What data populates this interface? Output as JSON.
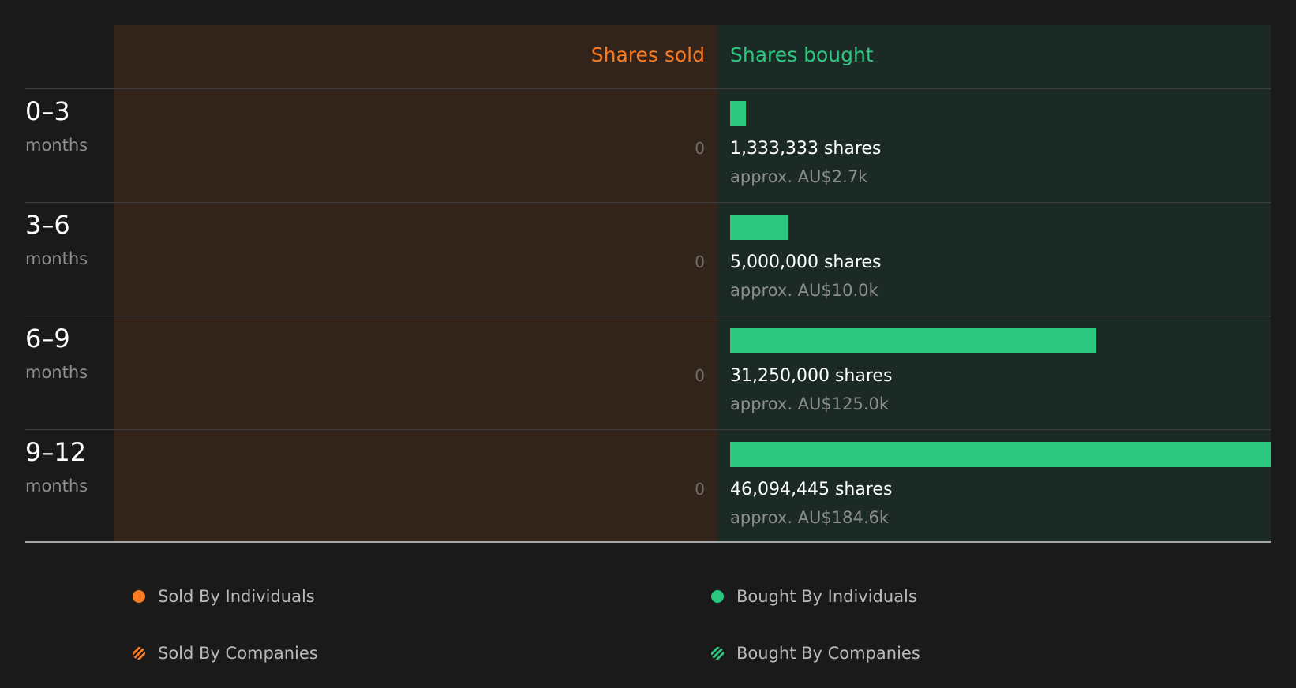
{
  "chart_data": {
    "type": "bar",
    "orientation": "horizontal",
    "headers": {
      "sold": "Shares sold",
      "bought": "Shares bought"
    },
    "categories": [
      {
        "period": "0–3",
        "unit": "months"
      },
      {
        "period": "3–6",
        "unit": "months"
      },
      {
        "period": "6–9",
        "unit": "months"
      },
      {
        "period": "9–12",
        "unit": "months"
      }
    ],
    "series": [
      {
        "name": "Shares sold",
        "values": [
          0,
          0,
          0,
          0
        ],
        "labels": [
          "0",
          "0",
          "0",
          "0"
        ]
      },
      {
        "name": "Shares bought",
        "values": [
          1333333,
          5000000,
          31250000,
          46094445
        ],
        "labels": [
          "1,333,333 shares",
          "5,000,000 shares",
          "31,250,000 shares",
          "46,094,445 shares"
        ],
        "value_labels": [
          "approx. AU$2.7k",
          "approx. AU$10.0k",
          "approx. AU$125.0k",
          "approx. AU$184.6k"
        ]
      }
    ],
    "legend": [
      {
        "label": "Sold By Individuals",
        "color": "#f97a1f",
        "pattern": "solid"
      },
      {
        "label": "Bought By Individuals",
        "color": "#2cc780",
        "pattern": "solid"
      },
      {
        "label": "Sold By Companies",
        "color": "#f97a1f",
        "pattern": "hatched"
      },
      {
        "label": "Bought By Companies",
        "color": "#2cc780",
        "pattern": "hatched"
      }
    ],
    "legend_placement": "bottom",
    "colors": {
      "sold": "#f97a1f",
      "bought": "#2cc780",
      "sold_panel": "#32231b",
      "bought_panel": "#1b2a24",
      "background": "#1a1a1a"
    }
  }
}
